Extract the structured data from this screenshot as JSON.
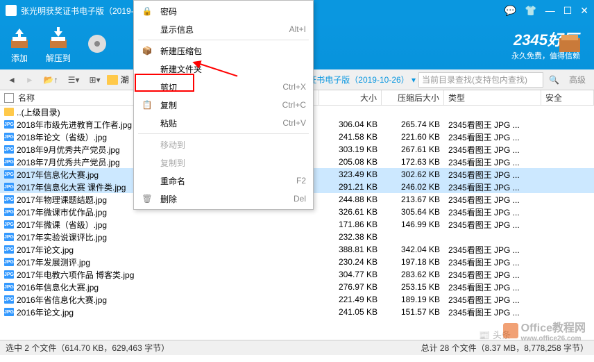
{
  "window": {
    "title": "张光明获奖证书电子版（2019-"
  },
  "toolbar": {
    "add": "添加",
    "extract": "解压到"
  },
  "brand": {
    "logo": "2345好压",
    "tag": "永久免费，值得信赖"
  },
  "nav": {
    "breadcrumb_prefix": "湖",
    "breadcrumb_suffix": "证书电子版（2019-10-26）",
    "search_placeholder": "当前目录查找(支持包内查找)",
    "advanced": "高级"
  },
  "headers": {
    "name": "名称",
    "size": "大小",
    "compressed": "压缩后大小",
    "type": "类型",
    "safe": "安全"
  },
  "context_menu": {
    "password": "密码",
    "show_info": "显示信息",
    "show_info_key": "Alt+I",
    "new_archive": "新建压缩包",
    "new_folder": "新建文件夹",
    "cut": "剪切",
    "cut_key": "Ctrl+X",
    "copy": "复制",
    "copy_key": "Ctrl+C",
    "paste": "粘贴",
    "paste_key": "Ctrl+V",
    "move_to": "移动到",
    "copy_to": "复制到",
    "rename": "重命名",
    "rename_key": "F2",
    "delete": "删除",
    "delete_key": "Del"
  },
  "files": [
    {
      "name": "..(上级目录)",
      "size": "",
      "comp": "",
      "type": "",
      "updir": true
    },
    {
      "name": "2018年市级先进教育工作者.jpg",
      "size": "306.04 KB",
      "comp": "265.74 KB",
      "type": "2345看图王 JPG ..."
    },
    {
      "name": "2018年论文（省级）.jpg",
      "size": "241.58 KB",
      "comp": "221.60 KB",
      "type": "2345看图王 JPG ..."
    },
    {
      "name": "2018年9月优秀共产党员.jpg",
      "size": "303.19 KB",
      "comp": "267.61 KB",
      "type": "2345看图王 JPG ..."
    },
    {
      "name": "2018年7月优秀共产党员.jpg",
      "size": "205.08 KB",
      "comp": "172.63 KB",
      "type": "2345看图王 JPG ..."
    },
    {
      "name": "2017年信息化大赛.jpg",
      "size": "323.49 KB",
      "comp": "302.62 KB",
      "type": "2345看图王 JPG ...",
      "selected": true
    },
    {
      "name": "2017年信息化大赛 课件类.jpg",
      "size": "291.21 KB",
      "comp": "246.02 KB",
      "type": "2345看图王 JPG ...",
      "selected": true
    },
    {
      "name": "2017年物理课题结题.jpg",
      "size": "244.88 KB",
      "comp": "213.67 KB",
      "type": "2345看图王 JPG ..."
    },
    {
      "name": "2017年微课市优作品.jpg",
      "size": "326.61 KB",
      "comp": "305.64 KB",
      "type": "2345看图王 JPG ..."
    },
    {
      "name": "2017年微课（省级）.jpg",
      "size": "171.86 KB",
      "comp": "146.99 KB",
      "type": "2345看图王 JPG ..."
    },
    {
      "name": "2017年实验说课评比.jpg",
      "size": "232.38 KB",
      "comp": "",
      "type": ""
    },
    {
      "name": "2017年论文.jpg",
      "size": "388.81 KB",
      "comp": "342.04 KB",
      "type": "2345看图王 JPG ..."
    },
    {
      "name": "2017年发展测评.jpg",
      "size": "230.24 KB",
      "comp": "197.18 KB",
      "type": "2345看图王 JPG ..."
    },
    {
      "name": "2017年电教六项作品 博客类.jpg",
      "size": "304.77 KB",
      "comp": "283.62 KB",
      "type": "2345看图王 JPG ..."
    },
    {
      "name": "2016年信息化大赛.jpg",
      "size": "276.97 KB",
      "comp": "253.15 KB",
      "type": "2345看图王 JPG ..."
    },
    {
      "name": "2016年省信息化大赛.jpg",
      "size": "221.49 KB",
      "comp": "189.19 KB",
      "type": "2345看图王 JPG ..."
    },
    {
      "name": "2016年论文.jpg",
      "size": "241.05 KB",
      "comp": "151.57 KB",
      "type": "2345看图王 JPG ..."
    }
  ],
  "status": {
    "left": "选中 2 个文件（614.70 KB，629,463 字节）",
    "right": "总计 28 个文件（8.37 MB，8,778,258 字节）"
  },
  "watermark": {
    "headline": "头条",
    "text": "Office教程网",
    "url": "www.office26.com"
  }
}
